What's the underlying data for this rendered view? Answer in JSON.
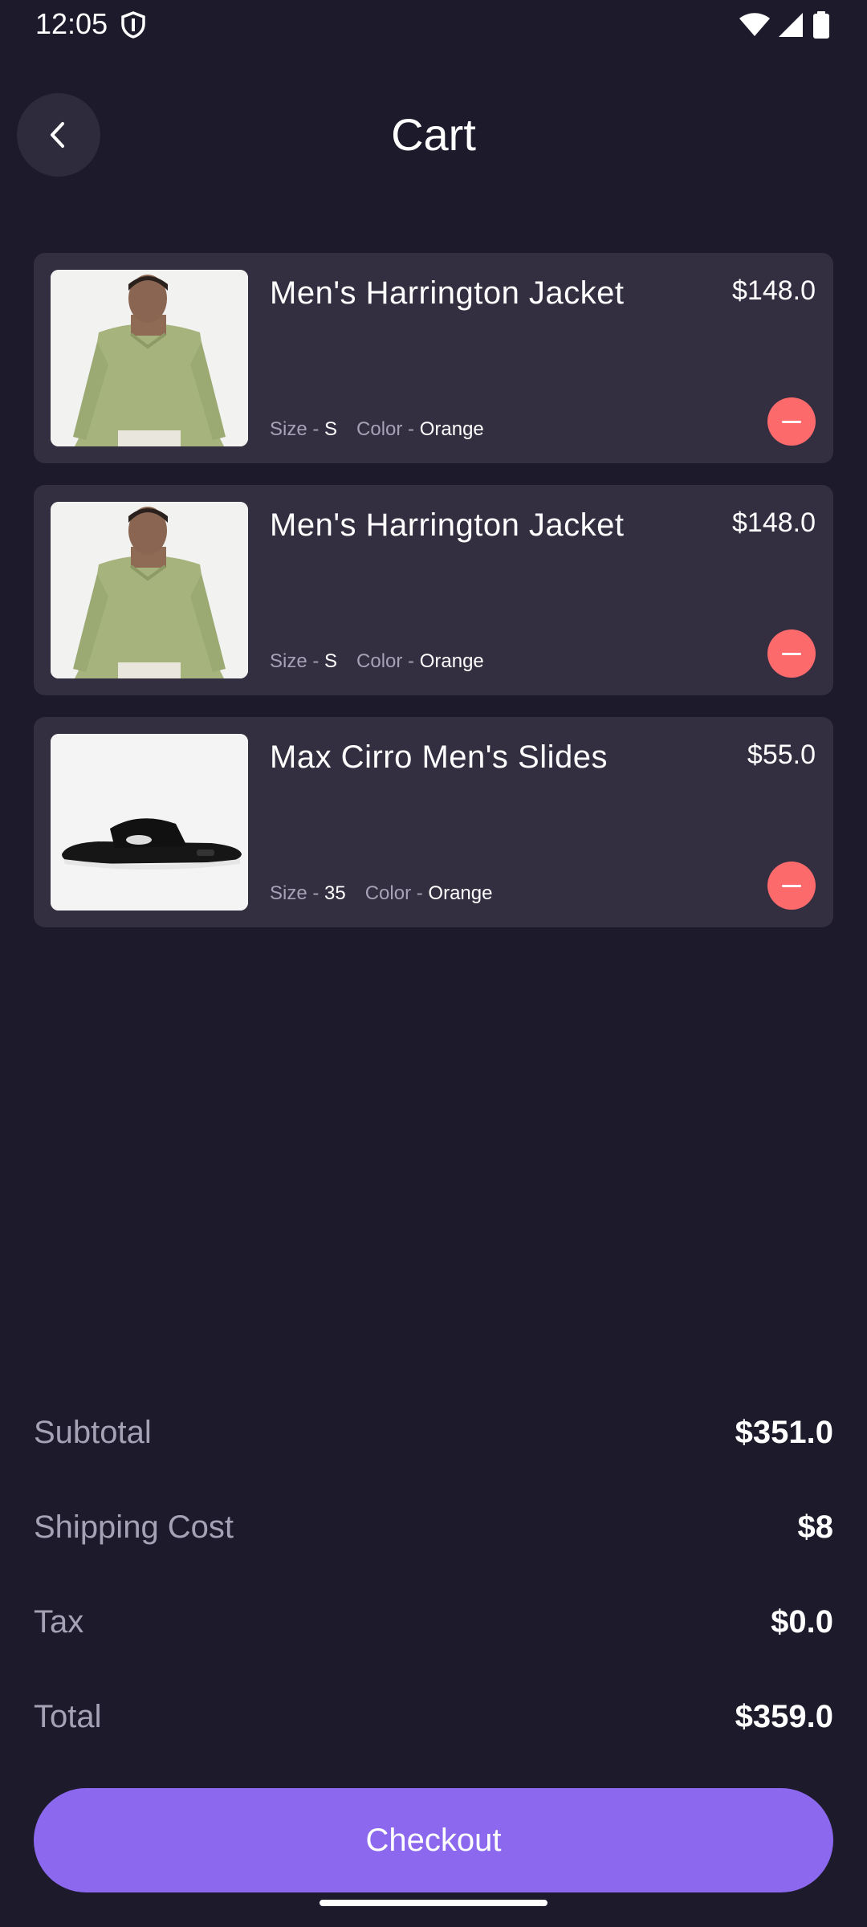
{
  "status_bar": {
    "time": "12:05"
  },
  "header": {
    "title": "Cart"
  },
  "cart": {
    "items": [
      {
        "name": "Men's Harrington Jacket",
        "price": "$148.0",
        "size_label": "Size - ",
        "size": "S",
        "color_label": "Color - ",
        "color": "Orange"
      },
      {
        "name": "Men's Harrington Jacket",
        "price": "$148.0",
        "size_label": "Size - ",
        "size": "S",
        "color_label": "Color - ",
        "color": "Orange"
      },
      {
        "name": "Max Cirro Men's Slides",
        "price": "$55.0",
        "size_label": "Size - ",
        "size": "35",
        "color_label": "Color - ",
        "color": "Orange"
      }
    ]
  },
  "summary": {
    "subtotal_label": "Subtotal",
    "subtotal_value": "$351.0",
    "shipping_label": "Shipping Cost",
    "shipping_value": "$8",
    "tax_label": "Tax",
    "tax_value": "$0.0",
    "total_label": "Total",
    "total_value": "$359.0"
  },
  "checkout": {
    "label": "Checkout"
  },
  "colors": {
    "background": "#1d1a2b",
    "card": "#332f41",
    "accent": "#8b68ee",
    "remove": "#fd6a6b"
  }
}
